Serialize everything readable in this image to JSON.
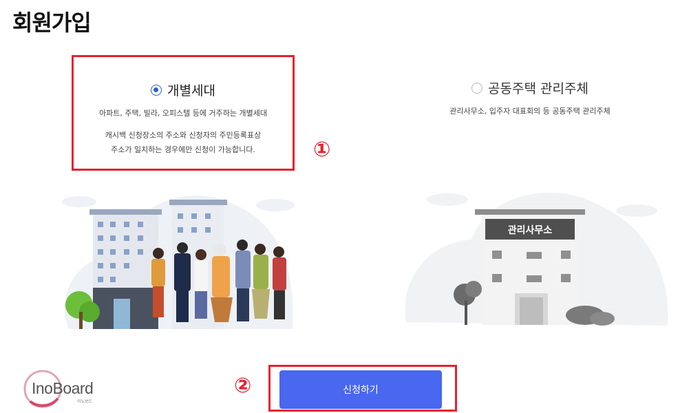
{
  "page": {
    "title": "회원가입"
  },
  "options": [
    {
      "title": "개별세대",
      "selected": true,
      "description": "아파트, 주택, 빌라, 오피스텔 등에 거주하는 개별세대",
      "note_line1": "캐시백 신청장소의 주소와 신청자의 주민등록표상",
      "note_line2": "주소가 일치하는 경우에만 신청이 가능합니다."
    },
    {
      "title": "공동주택 관리주체",
      "selected": false,
      "description": "관리사무소, 입주자 대표회의 등 공동주택 관리주체",
      "building_sign": "관리사무소"
    }
  ],
  "markers": {
    "first": "①",
    "second": "②"
  },
  "submit": {
    "label": "신청하기"
  },
  "logo": {
    "text": "InoBoard",
    "sub": "이노보드"
  },
  "colors": {
    "accent": "#4a67f0",
    "highlight": "#e8202f",
    "radio": "#2f5fcf"
  }
}
